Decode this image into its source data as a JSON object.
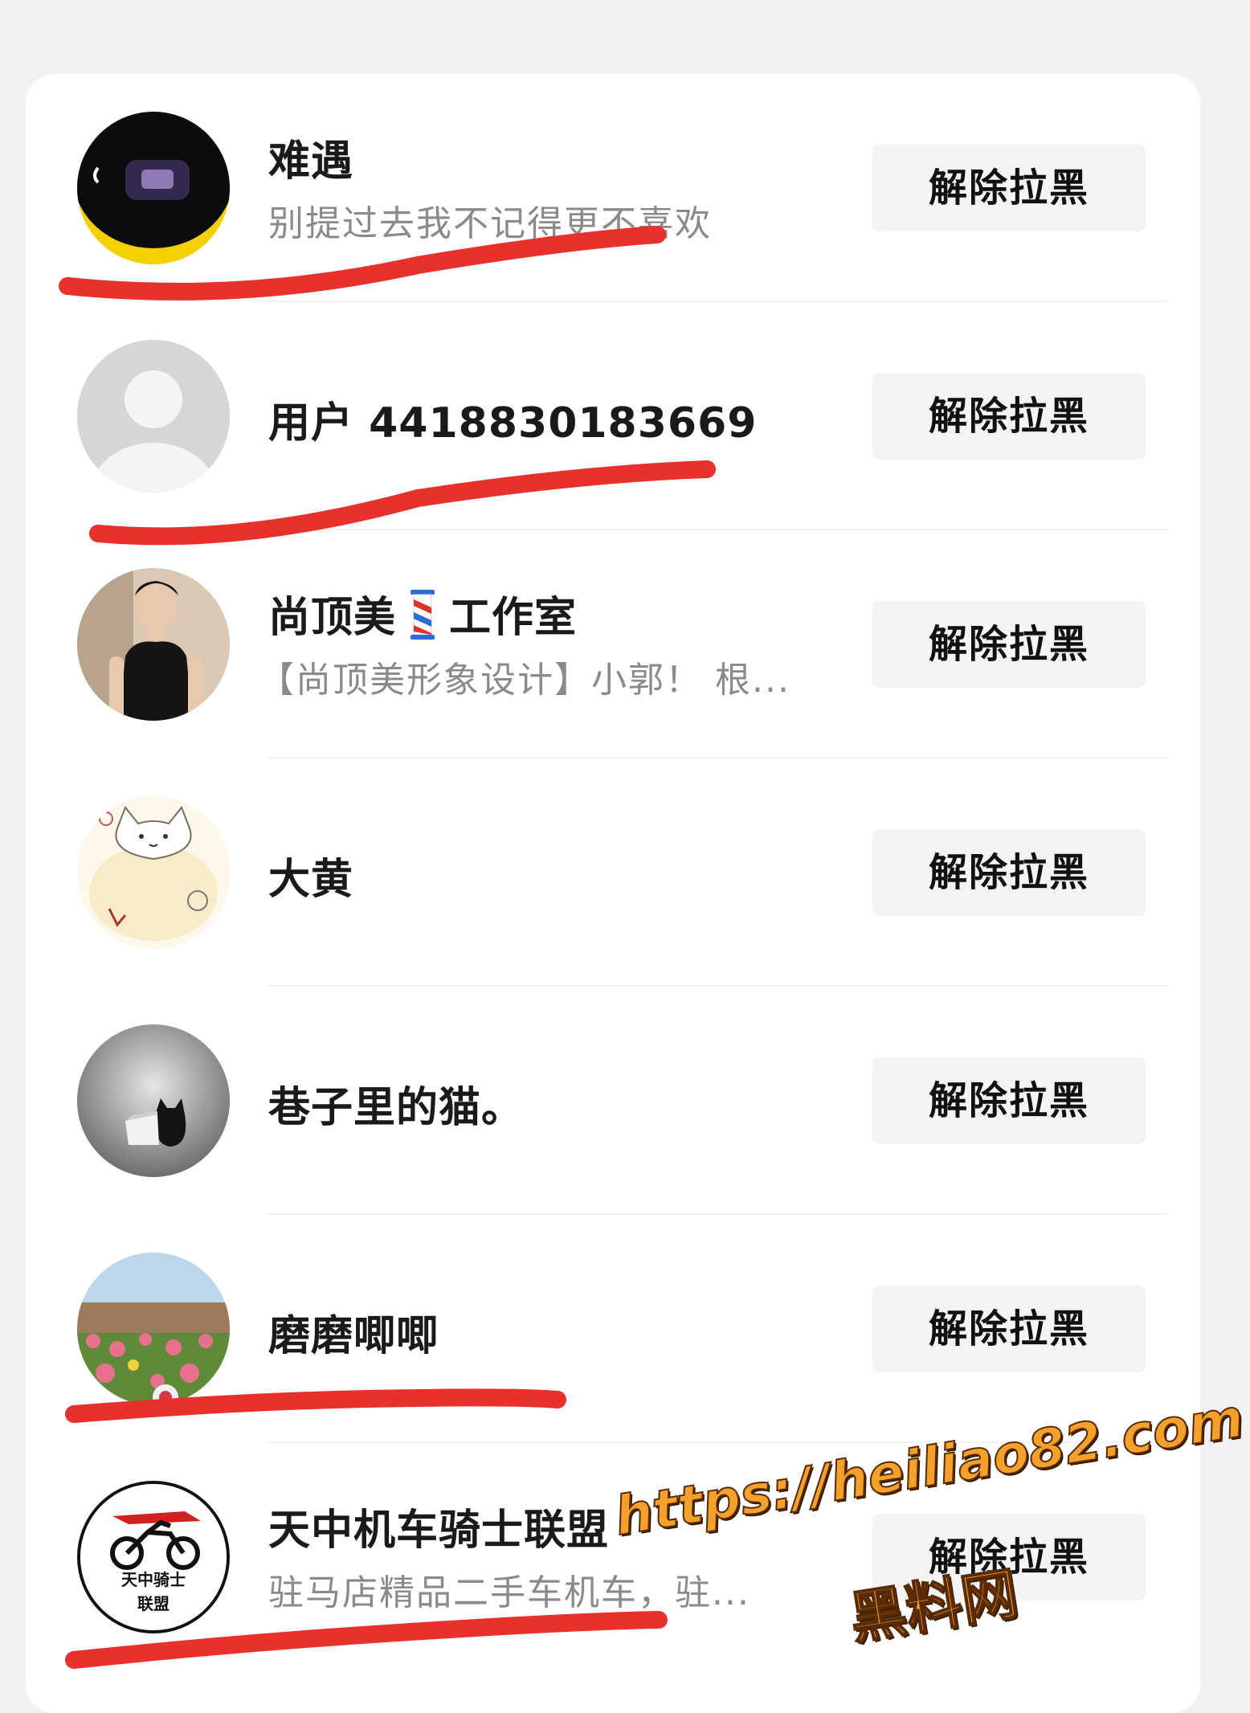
{
  "users": [
    {
      "name": "难遇",
      "subtitle": "别提过去我不记得更不喜欢",
      "action": "解除拉黑",
      "avatar": "dark-helmet-avatar"
    },
    {
      "name": "用户 4418830183669",
      "subtitle": "",
      "action": "解除拉黑",
      "avatar": "default-user-avatar"
    },
    {
      "name_prefix": "尚顶美",
      "name_suffix": "工作室",
      "name_icon": "barber-pole-icon",
      "subtitle": "【尚顶美形象设计】小郭！ 根...",
      "action": "解除拉黑",
      "avatar": "man-portrait-avatar"
    },
    {
      "name": "大黄",
      "subtitle": "",
      "action": "解除拉黑",
      "avatar": "cartoon-cat-avatar"
    },
    {
      "name": "巷子里的猫。",
      "subtitle": "",
      "action": "解除拉黑",
      "avatar": "black-cat-avatar"
    },
    {
      "name": "磨磨唧唧",
      "subtitle": "",
      "action": "解除拉黑",
      "avatar": "flower-field-avatar"
    },
    {
      "name": "天中机车骑士联盟",
      "subtitle": "驻马店精品二手车机车，驻...",
      "action": "解除拉黑",
      "avatar": "motorcycle-logo-avatar",
      "avatar_text": [
        "天中骑士",
        "联盟"
      ]
    }
  ],
  "watermark": {
    "url": "https://heiliao82.com",
    "label": "黑料网"
  },
  "colors": {
    "annotation_red": "#e8302c",
    "button_bg": "#f4f4f6",
    "watermark_orange": "#f3a12a"
  }
}
